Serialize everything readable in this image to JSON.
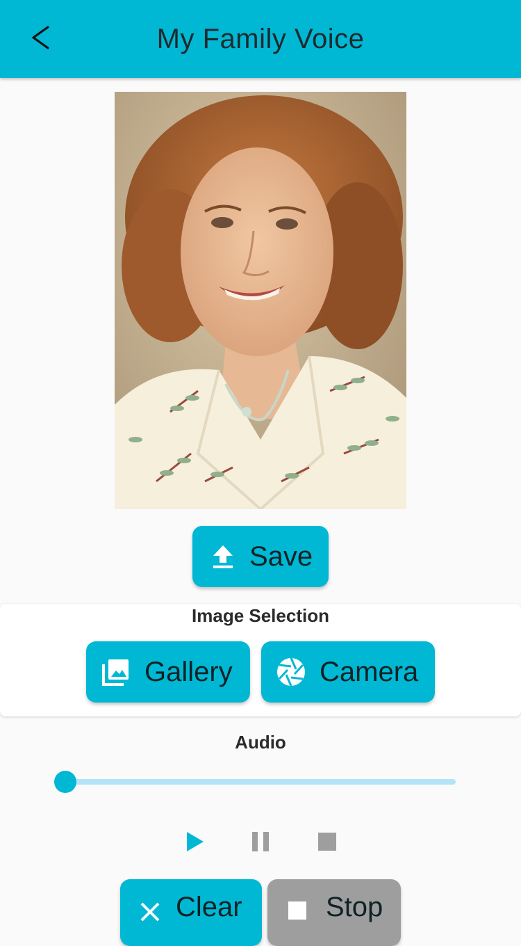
{
  "appbar": {
    "title": "My Family Voice",
    "back_icon": "chevron-left-icon"
  },
  "photo": {
    "description_icon": "portrait-photo"
  },
  "save_button": {
    "label": "Save",
    "icon": "upload-icon"
  },
  "image_selection": {
    "title": "Image Selection",
    "gallery_label": "Gallery",
    "gallery_icon": "gallery-icon",
    "camera_label": "Camera",
    "camera_icon": "camera-shutter-icon"
  },
  "audio": {
    "title": "Audio",
    "progress": 0.0,
    "controls": [
      "play-icon",
      "pause-icon",
      "stop-icon"
    ]
  },
  "bottom_buttons": {
    "clear_label": "Clear",
    "clear_icon": "close-icon",
    "stop_label": "Stop",
    "stop_icon": "stop-icon"
  },
  "colors": {
    "accent": "#00b8d4",
    "slider_track": "#b3e3f6",
    "disabled": "#9e9e9e",
    "background": "#fafafa"
  }
}
